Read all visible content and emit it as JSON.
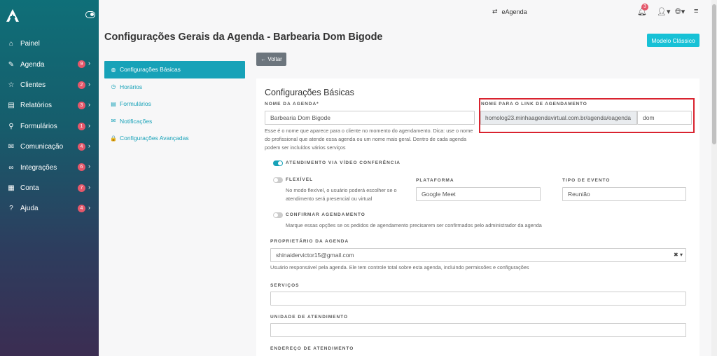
{
  "sidebar": {
    "items": [
      {
        "label": "Painel",
        "icon": "home-icon",
        "glyph": "⌂",
        "badge": ""
      },
      {
        "label": "Agenda",
        "icon": "edit-icon",
        "glyph": "✎",
        "badge": "9"
      },
      {
        "label": "Clientes",
        "icon": "star-icon",
        "glyph": "☆",
        "badge": "2"
      },
      {
        "label": "Relatórios",
        "icon": "book-icon",
        "glyph": "▤",
        "badge": "3"
      },
      {
        "label": "Formulários",
        "icon": "search-icon",
        "glyph": "⚲",
        "badge": "1"
      },
      {
        "label": "Comunicação",
        "icon": "mail-icon",
        "glyph": "✉",
        "badge": "4"
      },
      {
        "label": "Integrações",
        "icon": "link-icon",
        "glyph": "∞",
        "badge": "6"
      },
      {
        "label": "Conta",
        "icon": "building-icon",
        "glyph": "▦",
        "badge": "7"
      },
      {
        "label": "Ajuda",
        "icon": "help-icon",
        "glyph": "?",
        "badge": "4"
      }
    ]
  },
  "topbar": {
    "eagenda": "eAgenda",
    "bell_count": "3"
  },
  "page": {
    "title": "Configurações Gerais da Agenda - Barbearia Dom Bigode",
    "classic_button": "Modelo Clássico",
    "back_button": "← Voltar"
  },
  "settings_nav": [
    {
      "label": "Configurações Básicas",
      "glyph": "◍"
    },
    {
      "label": "Horários",
      "glyph": "◷"
    },
    {
      "label": "Formulários",
      "glyph": "▤"
    },
    {
      "label": "Notificações",
      "glyph": "✉"
    },
    {
      "label": "Configurações Avançadas",
      "glyph": "🔒"
    }
  ],
  "form": {
    "card_title": "Configurações Básicas",
    "agenda_name_label": "NOME DA AGENDA*",
    "agenda_name_value": "Barbearia Dom Bigode",
    "agenda_name_help": "Esse é o nome que aparece para o cliente no momento do agendamento. Dica: use o nome do profissional que atende essa agenda ou um nome mais geral. Dentro de cada agenda podem ser incluídos vários serviços",
    "link_label": "NOME PARA O LINK DE AGENDAMENTO",
    "link_prefix": "homolog23.minhaagendavirtual.com.br/agenda/eagenda",
    "link_value": "dom",
    "video_label": "ATENDIMENTO VIA VÍDEO CONFERÊNCIA",
    "flexible_label": "FLEXÍVEL",
    "flexible_help": "No modo flexível, o usuário poderá escolher se o atendimento será presencial ou virtual",
    "platform_label": "PLATAFORMA",
    "platform_value": "Google Meet",
    "event_type_label": "TIPO DE EVENTO",
    "event_type_value": "Reunião",
    "confirm_label": "CONFIRMAR AGENDAMENTO",
    "confirm_help": "Marque essas opções se os pedidos de agendamento precisarem ser confirmados pelo administrador da agenda",
    "owner_label": "PROPRIETÁRIO DA AGENDA",
    "owner_value": "shinaidervictor15@gmail.com",
    "owner_help": "Usuário responsável pela agenda. Ele tem controle total sobre esta agenda, incluindo permissões e configurações",
    "services_label": "SERVIÇOS",
    "unit_label": "UNIDADE DE ATENDIMENTO",
    "address_label": "ENDEREÇO DE ATENDIMENTO"
  }
}
